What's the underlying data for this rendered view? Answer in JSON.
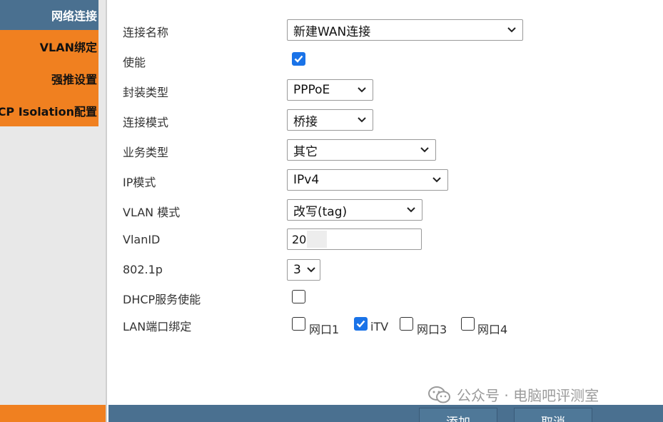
{
  "sidebar": {
    "items": [
      {
        "label": "网络连接"
      },
      {
        "label": "VLAN绑定"
      },
      {
        "label": "强推设置"
      },
      {
        "label": "CP Isolation配置"
      }
    ]
  },
  "form": {
    "connection_name": {
      "label": "连接名称",
      "value": "新建WAN连接"
    },
    "enable": {
      "label": "使能",
      "checked": true
    },
    "encapsulation": {
      "label": "封装类型",
      "value": "PPPoE"
    },
    "connection_mode": {
      "label": "连接模式",
      "value": "桥接"
    },
    "service_type": {
      "label": "业务类型",
      "value": "其它"
    },
    "ip_mode": {
      "label": "IP模式",
      "value": "IPv4"
    },
    "vlan_mode": {
      "label": "VLAN 模式",
      "value": "改写(tag)"
    },
    "vlan_id": {
      "label": "VlanID",
      "value": "20"
    },
    "priority": {
      "label": "802.1p",
      "value": "3"
    },
    "dhcp_enable": {
      "label": "DHCP服务使能",
      "checked": false
    },
    "lan_binding": {
      "label": "LAN端口绑定",
      "ports": [
        {
          "label": "网口1",
          "checked": false
        },
        {
          "label": "iTV",
          "checked": true
        },
        {
          "label": "网口3",
          "checked": false
        },
        {
          "label": "网口4",
          "checked": false
        }
      ]
    }
  },
  "watermark": {
    "text": "公众号 · 电脑吧评测室"
  },
  "buttons": {
    "add": "添加",
    "cancel": "取消"
  },
  "colors": {
    "sidebar_active": "#4a7090",
    "sidebar_orange": "#f08020",
    "checkbox_checked": "#1a73e8",
    "bottom_bar": "#4a7090"
  }
}
